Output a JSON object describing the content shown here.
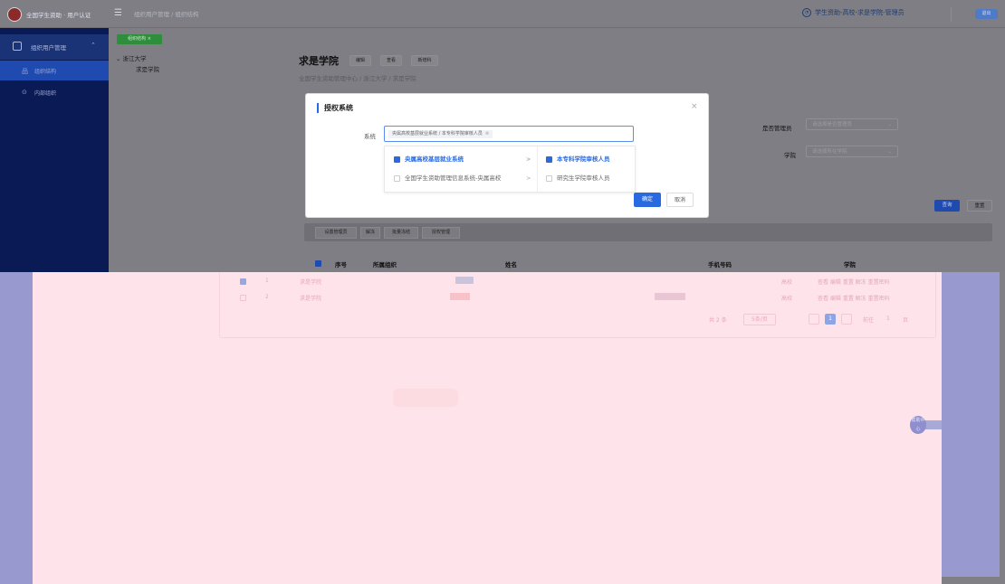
{
  "header": {
    "app_title": "全国学生资助 · 用户认证",
    "breadcrumb": "组织用户管理 / 组织结构",
    "user": "学生资助-高校-求是学院-管理员",
    "exit_label": "退出"
  },
  "sidebar": {
    "group_label": "组织用户管理",
    "items": [
      {
        "label": "组织结构",
        "active": true
      },
      {
        "label": "内部组织",
        "active": false
      }
    ]
  },
  "main": {
    "tab_tag": "组织结构 ×",
    "tree": {
      "root": "浙江大学",
      "child": "求是学院"
    },
    "college_name": "求是学院",
    "pills": [
      "编辑",
      "查看",
      "新增科"
    ],
    "path": "全国学生资助管理中心 / 浙江大学 / 求是学院",
    "filters": {
      "admin_label": "是否管理员",
      "admin_placeholder": "请选择是否管理员",
      "dept_label": "学院",
      "dept_placeholder": "请选择所在学院"
    },
    "query_label": "查询",
    "reset_label": "重置",
    "actions": [
      "设置管理员",
      "解冻",
      "批量冻结",
      "授权管理"
    ],
    "table_headers": [
      "序号",
      "所属组织",
      "姓名",
      "手机号码",
      "学院"
    ]
  },
  "dialog": {
    "title": "授权系统",
    "field_label": "系统",
    "selected_value": "央属高校基层就业系统 / 本专科学院审核人员",
    "column1": [
      {
        "label": "央属高校基层就业系统",
        "checked": true,
        "selected": true
      },
      {
        "label": "全国学生资助管理信息系统-央属高校",
        "checked": false,
        "selected": false
      }
    ],
    "column2": [
      {
        "label": "本专科学院审核人员",
        "checked": true,
        "selected": true
      },
      {
        "label": "研究生学院审核人员",
        "checked": false,
        "selected": false
      }
    ],
    "confirm_label": "确定",
    "cancel_label": "取消"
  },
  "table": {
    "rows": [
      {
        "index": "1",
        "org": "求是学院",
        "type": "高校",
        "ops": "查看 编辑 重置 解冻 重置密码",
        "checked": true
      },
      {
        "index": "2",
        "org": "求是学院",
        "type": "高校",
        "ops": "查看 编辑 重置 解冻 重置密码",
        "checked": false
      }
    ],
    "pager": {
      "total": "共 2 条",
      "page_size": "5条/页",
      "current": "1",
      "goto_label": "前往",
      "goto_value": "1",
      "page_unit": "页"
    }
  },
  "float_button": "帮助中心",
  "colors": {
    "accent": "#2a6ae0",
    "sidebar": "#0a1a55",
    "artifact_pink": "#fee3ea",
    "artifact_blue": "#9799cf"
  }
}
